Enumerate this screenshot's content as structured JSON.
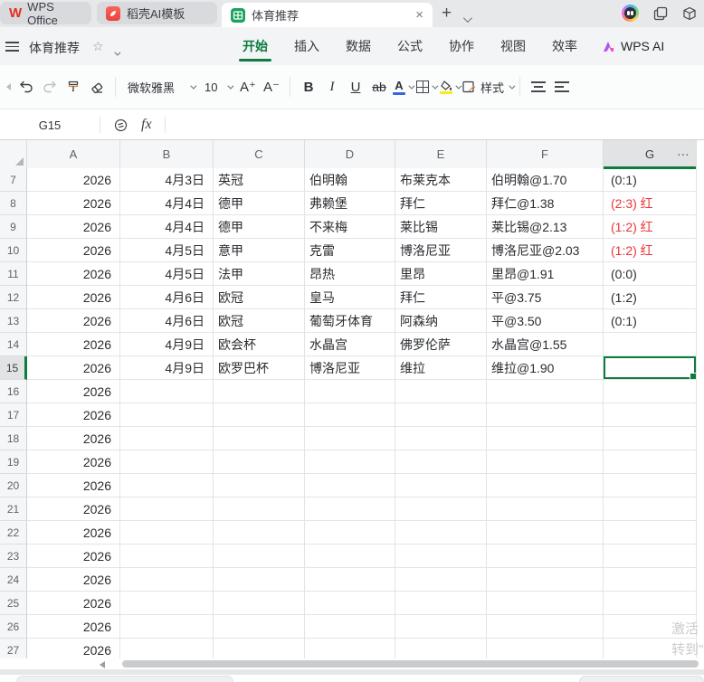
{
  "tab_bar": {
    "tabs": [
      {
        "label": "WPS Office"
      },
      {
        "label": "稻壳AI模板"
      },
      {
        "label": "体育推荐"
      }
    ],
    "close_glyph": "×",
    "new_tab_glyph": "+"
  },
  "menu_bar": {
    "doc_title": "体育推荐",
    "star_glyph": "☆",
    "items": [
      "开始",
      "插入",
      "数据",
      "公式",
      "协作",
      "视图",
      "效率"
    ],
    "active_item": "开始",
    "ai_label": "WPS AI"
  },
  "toolbar": {
    "font_name": "微软雅黑",
    "font_size": "10",
    "bold": "B",
    "italic": "I",
    "underline": "U",
    "strike": "ab",
    "font_color_glyph": "A",
    "increase_font_glyph": "A⁺",
    "decrease_font_glyph": "A⁻",
    "style_label": "样式"
  },
  "formula_bar": {
    "name_box": "G15",
    "fx_label": "fx"
  },
  "grid": {
    "column_headers": [
      "A",
      "B",
      "C",
      "D",
      "E",
      "F",
      "G"
    ],
    "selected_column": "G",
    "selected_row": 15,
    "selected_cell": "G15",
    "header_more_glyph": "⋯",
    "rows": [
      {
        "n": "7",
        "a": "2026",
        "b": "4月3日",
        "c": "英冠",
        "d": "伯明翰",
        "e": "布莱克本",
        "f": "伯明翰@1.70",
        "g": "(0:1)",
        "red": false
      },
      {
        "n": "8",
        "a": "2026",
        "b": "4月4日",
        "c": "德甲",
        "d": "弗赖堡",
        "e": "拜仁",
        "f": "拜仁@1.38",
        "g": "(2:3) 红",
        "red": true
      },
      {
        "n": "9",
        "a": "2026",
        "b": "4月4日",
        "c": "德甲",
        "d": "不来梅",
        "e": "莱比锡",
        "f": "莱比锡@2.13",
        "g": "(1:2) 红",
        "red": true
      },
      {
        "n": "10",
        "a": "2026",
        "b": "4月5日",
        "c": "意甲",
        "d": "克雷",
        "e": "博洛尼亚",
        "f": "博洛尼亚@2.03",
        "g": "(1:2) 红",
        "red": true
      },
      {
        "n": "11",
        "a": "2026",
        "b": "4月5日",
        "c": "法甲",
        "d": "昂热",
        "e": "里昂",
        "f": "里昂@1.91",
        "g": "(0:0)",
        "red": false
      },
      {
        "n": "12",
        "a": "2026",
        "b": "4月6日",
        "c": "欧冠",
        "d": "皇马",
        "e": "拜仁",
        "f": "平@3.75",
        "g": "(1:2)",
        "red": false
      },
      {
        "n": "13",
        "a": "2026",
        "b": "4月6日",
        "c": "欧冠",
        "d": "葡萄牙体育",
        "e": "阿森纳",
        "f": "平@3.50",
        "g": "(0:1)",
        "red": false
      },
      {
        "n": "14",
        "a": "2026",
        "b": "4月9日",
        "c": "欧会杯",
        "d": "水晶宫",
        "e": "佛罗伦萨",
        "f": "水晶宫@1.55",
        "g": "",
        "red": false
      },
      {
        "n": "15",
        "a": "2026",
        "b": "4月9日",
        "c": "欧罗巴杯",
        "d": "博洛尼亚",
        "e": "维拉",
        "f": "维拉@1.90",
        "g": "",
        "red": false
      },
      {
        "n": "16",
        "a": "2026",
        "b": "",
        "c": "",
        "d": "",
        "e": "",
        "f": "",
        "g": "",
        "red": false
      },
      {
        "n": "17",
        "a": "2026",
        "b": "",
        "c": "",
        "d": "",
        "e": "",
        "f": "",
        "g": "",
        "red": false
      },
      {
        "n": "18",
        "a": "2026",
        "b": "",
        "c": "",
        "d": "",
        "e": "",
        "f": "",
        "g": "",
        "red": false
      },
      {
        "n": "19",
        "a": "2026",
        "b": "",
        "c": "",
        "d": "",
        "e": "",
        "f": "",
        "g": "",
        "red": false
      },
      {
        "n": "20",
        "a": "2026",
        "b": "",
        "c": "",
        "d": "",
        "e": "",
        "f": "",
        "g": "",
        "red": false
      },
      {
        "n": "21",
        "a": "2026",
        "b": "",
        "c": "",
        "d": "",
        "e": "",
        "f": "",
        "g": "",
        "red": false
      },
      {
        "n": "22",
        "a": "2026",
        "b": "",
        "c": "",
        "d": "",
        "e": "",
        "f": "",
        "g": "",
        "red": false
      },
      {
        "n": "23",
        "a": "2026",
        "b": "",
        "c": "",
        "d": "",
        "e": "",
        "f": "",
        "g": "",
        "red": false
      },
      {
        "n": "24",
        "a": "2026",
        "b": "",
        "c": "",
        "d": "",
        "e": "",
        "f": "",
        "g": "",
        "red": false
      },
      {
        "n": "25",
        "a": "2026",
        "b": "",
        "c": "",
        "d": "",
        "e": "",
        "f": "",
        "g": "",
        "red": false
      },
      {
        "n": "26",
        "a": "2026",
        "b": "",
        "c": "",
        "d": "",
        "e": "",
        "f": "",
        "g": "",
        "red": false
      },
      {
        "n": "27",
        "a": "2026",
        "b": "",
        "c": "",
        "d": "",
        "e": "",
        "f": "",
        "g": "",
        "red": false
      }
    ]
  },
  "watermark": {
    "line1": "激活",
    "line2": "转到\""
  },
  "colors": {
    "accent_green": "#0e7b41",
    "alert_red": "#ef3333",
    "font_color_bar": "#3a66dd",
    "fill_color_bar": "#ffe815"
  }
}
